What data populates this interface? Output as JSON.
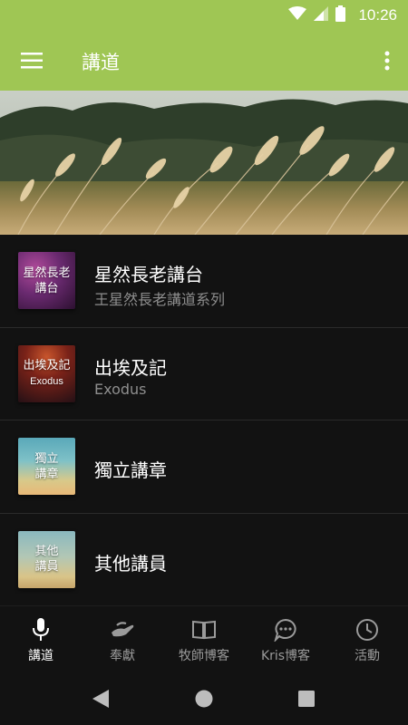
{
  "status_bar": {
    "time": "10:26",
    "icons": [
      "wifi-icon",
      "signal-icon",
      "battery-icon"
    ]
  },
  "app_bar": {
    "title": "講道",
    "menu_icon": "hamburger-menu-icon",
    "more_icon": "more-vertical-icon",
    "color": "#9fc654"
  },
  "hero": {
    "image": "wheat-field-banner"
  },
  "list": [
    {
      "thumb_lines": [
        "星然長老",
        "講台"
      ],
      "title": "星然長老講台",
      "subtitle": "王星然長老講道系列"
    },
    {
      "thumb_lines": [
        "出埃及記",
        "Exodus"
      ],
      "title": "出埃及記",
      "subtitle": "Exodus"
    },
    {
      "thumb_lines": [
        "獨立",
        "講章"
      ],
      "title": "獨立講章",
      "subtitle": ""
    },
    {
      "thumb_lines": [
        "其他",
        "講員"
      ],
      "title": "其他講員",
      "subtitle": ""
    }
  ],
  "bottom_nav": [
    {
      "label": "講道",
      "icon": "microphone-icon",
      "active": true
    },
    {
      "label": "奉獻",
      "icon": "offering-hand-icon",
      "active": false
    },
    {
      "label": "牧師博客",
      "icon": "book-open-icon",
      "active": false
    },
    {
      "label": "Kris博客",
      "icon": "chat-bubble-icon",
      "active": false
    },
    {
      "label": "活動",
      "icon": "clock-icon",
      "active": false
    }
  ],
  "system_nav": {
    "back": "back-triangle-icon",
    "home": "home-circle-icon",
    "recents": "recents-square-icon"
  }
}
